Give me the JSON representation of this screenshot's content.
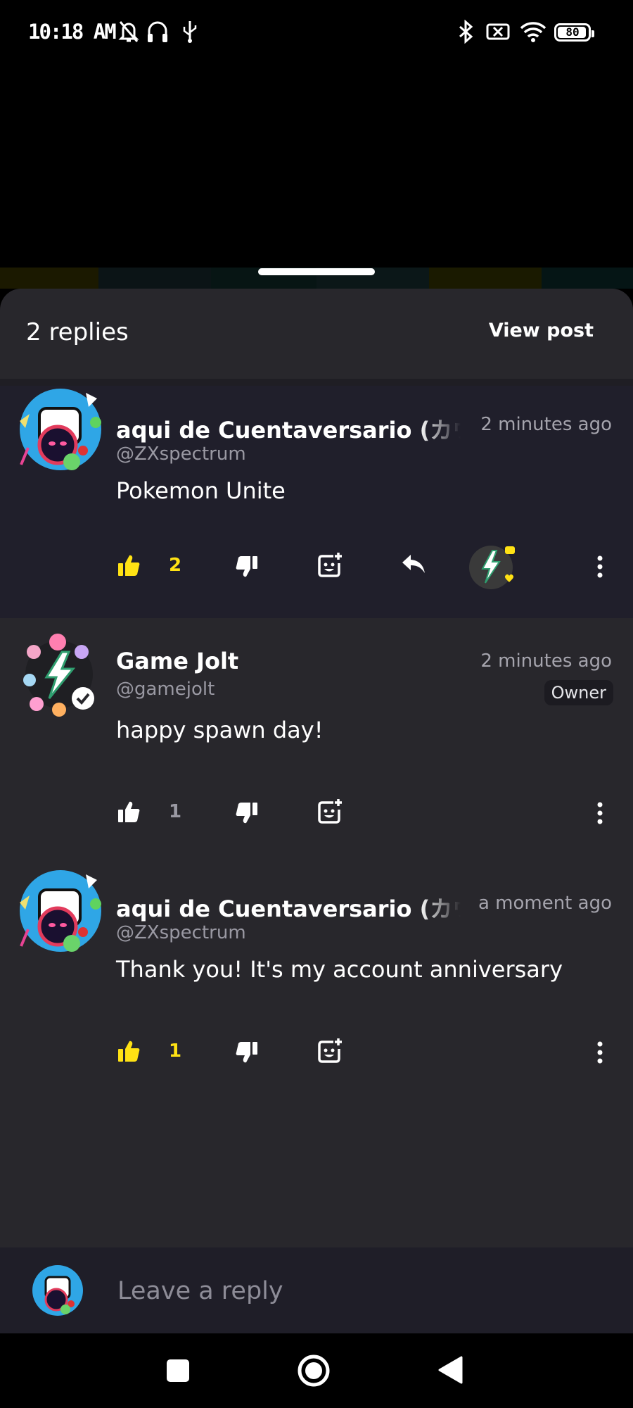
{
  "status_bar": {
    "time": "10:18 AM",
    "battery": "80"
  },
  "header": {
    "replies_count": "2 replies",
    "view_post": "View post"
  },
  "comments": [
    {
      "author": "aqui de Cuentaversario (カウン",
      "handle": "@ZXspectrum",
      "time": "2 minutes ago",
      "text": "Pokemon Unite",
      "likes": "2",
      "liked": true
    },
    {
      "author": "Game Jolt",
      "handle": "@gamejolt",
      "time": "2 minutes ago",
      "badge": "Owner",
      "text": "happy spawn day!",
      "likes": "1",
      "liked": false
    },
    {
      "author": "aqui de Cuentaversario (カウン",
      "handle": "@ZXspectrum",
      "time": "a moment ago",
      "text": "Thank you! It's my account anniversary",
      "likes": "1",
      "liked": true
    }
  ],
  "reply_bar": {
    "placeholder": "Leave a reply"
  },
  "colors": {
    "accent_yellow": "#ffe214",
    "sheet_bg": "#28272c",
    "highlight_bg": "#201f2b"
  }
}
